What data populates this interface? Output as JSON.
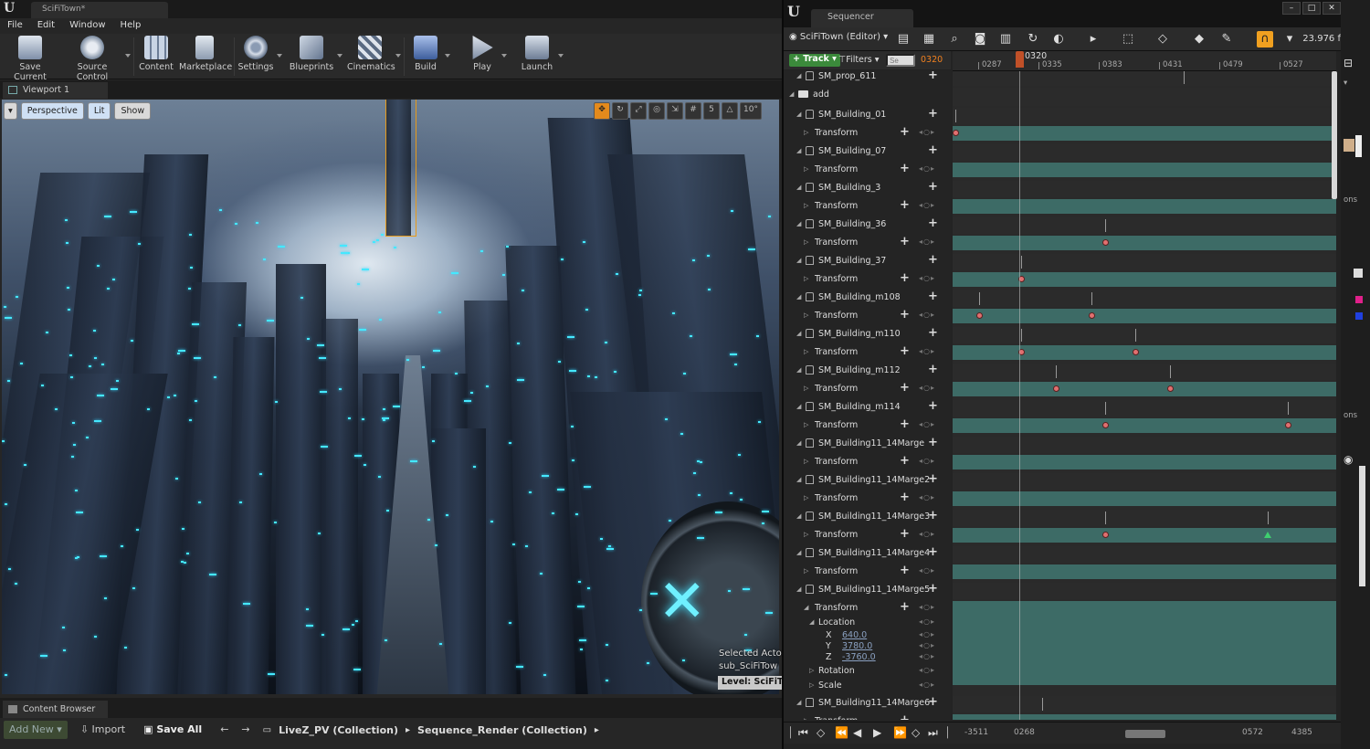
{
  "editor": {
    "doc_tab": "SciFiTown*",
    "menu": [
      "File",
      "Edit",
      "Window",
      "Help"
    ],
    "toolbar": [
      {
        "label": "Save Current",
        "icon": "save-icon"
      },
      {
        "label": "Source Control",
        "icon": "source-control-icon"
      },
      {
        "label": "Content",
        "icon": "content-icon"
      },
      {
        "label": "Marketplace",
        "icon": "marketplace-icon"
      },
      {
        "label": "Settings",
        "icon": "settings-icon"
      },
      {
        "label": "Blueprints",
        "icon": "blueprints-icon"
      },
      {
        "label": "Cinematics",
        "icon": "cinematics-icon"
      },
      {
        "label": "Build",
        "icon": "build-icon"
      },
      {
        "label": "Play",
        "icon": "play-icon"
      },
      {
        "label": "Launch",
        "icon": "launch-icon"
      }
    ],
    "viewport": {
      "tab": "Viewport 1",
      "perspective": "Perspective",
      "lit": "Lit",
      "show": "Show",
      "grid_value": "5",
      "angle_value": "10°",
      "selected_actor_label": "Selected Actor",
      "selected_actor_value": "sub_SciFiTow",
      "level_badge": "Level:  SciFiTo"
    },
    "content_browser": {
      "tab": "Content Browser",
      "add_new": "Add New",
      "import": "Import",
      "save_all": "Save All",
      "breadcrumbs": [
        "LiveZ_PV (Collection)",
        "Sequence_Render (Collection)"
      ]
    }
  },
  "sequencer": {
    "tab": "Sequencer",
    "sequence_name": "SciFiTown (Editor)",
    "fps": "23.976 f",
    "track_button": "Track",
    "filters_button": "Filters",
    "search_placeholder": "Se",
    "current_frame": "0320",
    "playhead_label": "0320",
    "ruler_ticks": [
      "0287",
      "0335",
      "0383",
      "0431",
      "0479",
      "0527"
    ],
    "rows": [
      {
        "label": "SM_prop_611",
        "kind": "actor"
      },
      {
        "label": "add",
        "kind": "folder"
      },
      {
        "label": "SM_Building_01",
        "kind": "actor"
      },
      {
        "label": "Transform",
        "kind": "transform"
      },
      {
        "label": "SM_Building_07",
        "kind": "actor"
      },
      {
        "label": "Transform",
        "kind": "transform"
      },
      {
        "label": "SM_Building_3",
        "kind": "actor"
      },
      {
        "label": "Transform",
        "kind": "transform"
      },
      {
        "label": "SM_Building_36",
        "kind": "actor"
      },
      {
        "label": "Transform",
        "kind": "transform"
      },
      {
        "label": "SM_Building_37",
        "kind": "actor"
      },
      {
        "label": "Transform",
        "kind": "transform"
      },
      {
        "label": "SM_Building_m108",
        "kind": "actor"
      },
      {
        "label": "Transform",
        "kind": "transform"
      },
      {
        "label": "SM_Building_m110",
        "kind": "actor"
      },
      {
        "label": "Transform",
        "kind": "transform"
      },
      {
        "label": "SM_Building_m112",
        "kind": "actor"
      },
      {
        "label": "Transform",
        "kind": "transform"
      },
      {
        "label": "SM_Building_m114",
        "kind": "actor"
      },
      {
        "label": "Transform",
        "kind": "transform"
      },
      {
        "label": "SM_Building11_14Marge",
        "kind": "actor"
      },
      {
        "label": "Transform",
        "kind": "transform"
      },
      {
        "label": "SM_Building11_14Marge2",
        "kind": "actor"
      },
      {
        "label": "Transform",
        "kind": "transform"
      },
      {
        "label": "SM_Building11_14Marge3",
        "kind": "actor"
      },
      {
        "label": "Transform",
        "kind": "transform"
      },
      {
        "label": "SM_Building11_14Marge4",
        "kind": "actor"
      },
      {
        "label": "Transform",
        "kind": "transform"
      },
      {
        "label": "SM_Building11_14Marge5",
        "kind": "actor"
      },
      {
        "label": "Transform",
        "kind": "transform-open"
      }
    ],
    "location": {
      "label": "Location",
      "x_label": "X",
      "x": "640.0",
      "y_label": "Y",
      "y": "3780.0",
      "z_label": "Z",
      "z": "-3760.0"
    },
    "rotation": "Rotation",
    "scale": "Scale",
    "last_actor": "SM_Building11_14Marge6",
    "last_transform": "Transform",
    "transport": {
      "range_start": "-3511",
      "view_start": "0268",
      "view_end": "0572",
      "range_end": "4385"
    }
  },
  "right_pane": {
    "label1": "ons",
    "label2": "ons"
  }
}
